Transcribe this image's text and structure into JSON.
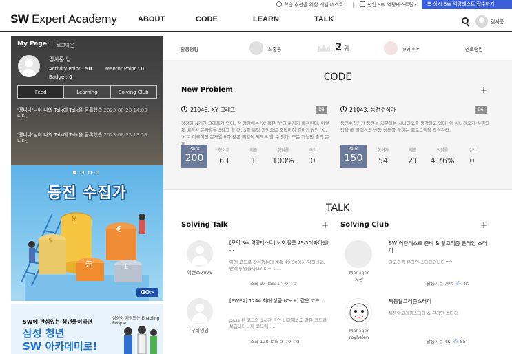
{
  "topbar": {
    "level_test": "학습 추천을 위한 레벨 테스트",
    "what_is_test": "신입 SW 역량테스트란?",
    "apply": "상시 SW 역량테스트 접수하기"
  },
  "header": {
    "logo_bold": "SW",
    "logo_rest": " Expert Academy",
    "nav": [
      "ABOUT",
      "CODE",
      "LEARN",
      "TALK"
    ],
    "user": "김사롱"
  },
  "mypage": {
    "title": "My Page",
    "logout": "로그아웃",
    "name": "김사롱   님",
    "activity_label": "Activity Point : ",
    "activity_value": "50",
    "mentor_label": "Mentor Point : ",
    "mentor_value": "0",
    "badge_label": "Badge : ",
    "badge_value": "0",
    "tabs": [
      "Feed",
      "Learning",
      "Solving Club"
    ],
    "feeds": [
      {
        "text": "'뗑니나'님이 나의 Talk에 Talk을 등록했습",
        "date": "2023-08-23 14:03",
        "tail": "니다."
      },
      {
        "text": "'뗑니나'님이 나의 Talk에 Talk을 등록했습",
        "date": "2023-08-23 13:58",
        "tail": "니다."
      }
    ]
  },
  "banner1": {
    "title": "동전 수집가",
    "go": "GO>"
  },
  "banner2": {
    "brand": "삼성이 키워드는 Enabling People",
    "sub": "SW에 관심있는 청년들이라면",
    "main1": "삼성 청년",
    "main2": "SW 아카데미로!"
  },
  "ranking": {
    "activity": "활동랭킹",
    "user1": "최홍용",
    "rank_num": "2",
    "rank_unit": "위",
    "user2": "pyjune",
    "mentor": "멘토랭킹"
  },
  "code": {
    "title": "CODE",
    "new_problem": "New Problem",
    "problems": [
      {
        "title": "21048. XY 그래프",
        "level": "D8",
        "desc": "정정아 N개인 그래프가 있다. 각 정점에는 'X' 혹은 'Y'의 문자가 배정된다. 이렇게 배정된 문자열을 S라고 할 때, S를 특정 과정으로 조작하여 길이가 N인 'X', 'Y'로 이루어진 문자열 R과 같은 배열이 되도록 할 수 있다. 모든 가능한 출력 문제 ...",
        "point_label": "Point",
        "point": "200",
        "stats": [
          {
            "label": "참여자",
            "value": "63"
          },
          {
            "label": "제출",
            "value": "1"
          },
          {
            "label": "정답률",
            "value": "100%"
          },
          {
            "label": "추천",
            "value": "0"
          }
        ]
      },
      {
        "title": "21043. 동전수집가",
        "level": "D6",
        "desc": "동전수집가가 동전을 처분하는 시나리오를 생각하고 있다. 이 시나리오가 실행되었을 때 콜렉션의 변동 상태를 구하는 프로그램을 작성하라.",
        "point_label": "Point",
        "point": "150",
        "stats": [
          {
            "label": "참여자",
            "value": "54"
          },
          {
            "label": "제출",
            "value": "21"
          },
          {
            "label": "정답률",
            "value": "4.76%"
          },
          {
            "label": "추천",
            "value": "0"
          }
        ]
      }
    ]
  },
  "talk": {
    "title": "TALK",
    "solving_talk": "Solving Talk",
    "solving_club": "Solving Club",
    "talks": [
      {
        "user": "이현호7979",
        "title": "[모의 SW 역량테스트] 보호 필름 49/50(파이썬) ...",
        "body": "아래 코드로 작성했는데 계속 49/50에서 막히네요, 반례가 있을까요? k = 1 ...",
        "meta": "조회 97   Talk 1   ♡0   ♡0"
      },
      {
        "user": "부비빙빙",
        "title": "[SWEA] 1244 최대 상금 (C++) 같은 코드 ...",
        "body": "pass 된 코드와 1시간 동안 비교해봐도 같은 코드로 보입니다.. 제 코드에 ...",
        "meta": "조회 128   Talk 0   ♡0   ♡0"
      }
    ],
    "clubs": [
      {
        "tag1": "Manager",
        "tag2": "서찡",
        "title": "SW 역량테스트 준비 & 알고리즘 온라인 스터디",
        "desc": "알고리즘 온라인 스터디입니다^^",
        "activity": "활동지수 79K",
        "members": "4K"
      },
      {
        "tag1": "Manager",
        "tag2": "royhelen",
        "title": "특동알고리즘스터디",
        "desc": "특동알고리즘스터디 & 온라인 스터디",
        "activity": "활동지수 4K",
        "members": "85"
      }
    ]
  }
}
